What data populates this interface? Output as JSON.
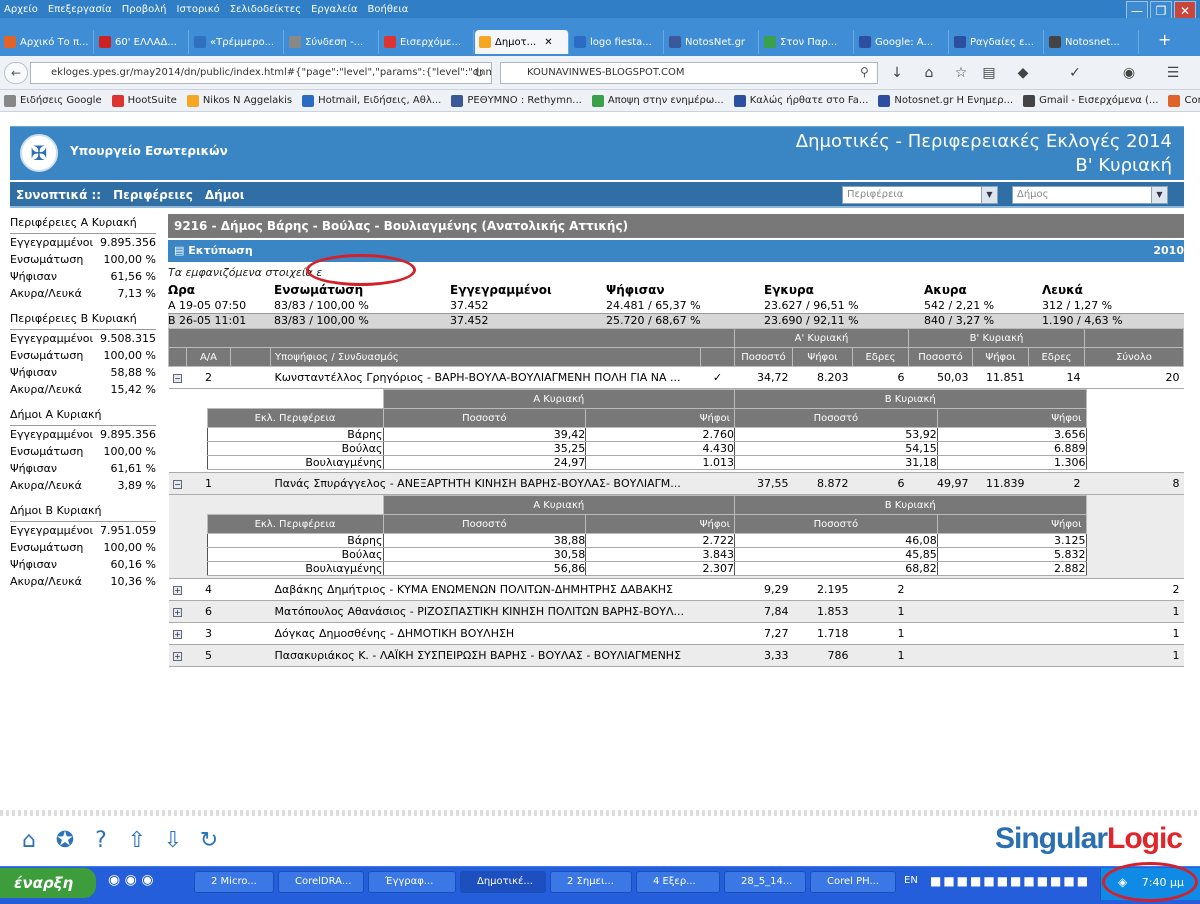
{
  "browser": {
    "menu": [
      "Αρχείο",
      "Επεξεργασία",
      "Προβολή",
      "Ιστορικό",
      "Σελιδοδείκτες",
      "Εργαλεία",
      "Βοήθεια"
    ],
    "tabs": [
      "Αρχικό Το π...",
      "60' ΕΛΛΑΔ...",
      "«Τρέμμερο...",
      "Σύνδεση -...",
      "Εισερχόμε...",
      "Δημοτ...",
      "logo fiesta...",
      "NotosNet.gr",
      "Στον Παρ...",
      "Google: Α...",
      "Ραγδαίες ε...",
      "Notosnet..."
    ],
    "active_tab_index": 5,
    "url": "ekloges.ypes.gr/may2014/dn/public/index.html#{\"page\":\"level\",\"params\":{\"level\":\"dnm",
    "search": "KOUNAVINWES-BLOGSPOT.COM",
    "bookmarks": [
      "Ειδήσεις Google",
      "HootSuite",
      "Nikos N Aggelakis",
      "Hotmail, Ειδήσεις, Αθλ...",
      "ΡΕΘΥΜΝΟ : Rethymn...",
      "Αποψη στην ενημέρω...",
      "Καλώς ήρθατε στο Fa...",
      "Notosnet.gr Η Ενημερ...",
      "Gmail - Εισερχόμενα (...",
      "Control Panel"
    ]
  },
  "header": {
    "ministry": "Υπουργείο Εσωτερικών",
    "title_line1": "Δημοτικές - Περιφερειακές Εκλογές 2014",
    "title_line2": "Β' Κυριακή"
  },
  "nav": {
    "links": [
      "Συνοπτικά ::",
      "Περιφέρειες",
      "Δήμοι"
    ],
    "select_region": "Περιφέρεια",
    "select_municipality": "Δήμος"
  },
  "sidebar": [
    {
      "title": "Περιφέρειες Α Κυριακή",
      "rows": [
        [
          "Εγγεγραμμένοι",
          "9.895.356"
        ],
        [
          "Ενσωμάτωση",
          "100,00 %"
        ],
        [
          "Ψήφισαν",
          "61,56 %"
        ],
        [
          "Ακυρα/Λευκά",
          "7,13 %"
        ]
      ]
    },
    {
      "title": "Περιφέρειες Β Κυριακή",
      "rows": [
        [
          "Εγγεγραμμένοι",
          "9.508.315"
        ],
        [
          "Ενσωμάτωση",
          "100,00 %"
        ],
        [
          "Ψήφισαν",
          "58,88 %"
        ],
        [
          "Ακυρα/Λευκά",
          "15,42 %"
        ]
      ]
    },
    {
      "title": "Δήμοι Α Κυριακή",
      "rows": [
        [
          "Εγγεγραμμένοι",
          "9.895.356"
        ],
        [
          "Ενσωμάτωση",
          "100,00 %"
        ],
        [
          "Ψήφισαν",
          "61,61 %"
        ],
        [
          "Ακυρα/Λευκά",
          "3,89 %"
        ]
      ]
    },
    {
      "title": "Δήμοι Β Κυριακή",
      "rows": [
        [
          "Εγγεγραμμένοι",
          "7.951.059"
        ],
        [
          "Ενσωμάτωση",
          "100,00 %"
        ],
        [
          "Ψήφισαν",
          "60,16 %"
        ],
        [
          "Ακυρα/Λευκά",
          "10,36 %"
        ]
      ]
    }
  ],
  "main": {
    "heading": "9216 - Δήμος Βάρης - Βούλας - Βουλιαγμένης (Ανατολικής Αττικής)",
    "print": "Εκτύπωση",
    "year": "2010",
    "note": "Τα εμφανιζόμενα στοιχεία ε",
    "summary_headers": [
      "Ωρα",
      "Ενσωμάτωση",
      "Εγγεγραμμένοι",
      "Ψήφισαν",
      "Εγκυρα",
      "Ακυρα",
      "Λευκά"
    ],
    "summary_rows": [
      [
        "A 19-05 07:50",
        "83/83 / 100,00 %",
        "37.452",
        "24.481 / 65,37 %",
        "23.627 / 96,51 %",
        "542 / 2,21 %",
        "312 / 1,27 %"
      ],
      [
        "B 26-05 11:01",
        "83/83 / 100,00 %",
        "37.452",
        "25.720 / 68,67 %",
        "23.690 / 92,11 %",
        "840 / 3,27 %",
        "1.190 / 4,63 %"
      ]
    ],
    "group_a": "Α' Κυριακή",
    "group_b": "Β' Κυριακή",
    "result_headers": [
      "Α/Α",
      "Υποψήφιος / Συνδυασμός",
      "Ποσοστό",
      "Ψήφοι",
      "Εδρες",
      "Ποσοστό",
      "Ψήφοι",
      "Εδρες",
      "Σύνολο"
    ],
    "sub_headers": {
      "district": "Εκλ. Περιφέρεια",
      "a": "Α Κυριακή",
      "b": "Β Κυριακή",
      "pct": "Ποσοστό",
      "votes": "Ψήφοι"
    },
    "candidates": [
      {
        "aa": "2",
        "name": "Κωνσταντέλλος Γρηγόριος - ΒΑΡΗ-ΒΟΥΛΑ-ΒΟΥΛΙΑΓΜΕΝΗ ΠΟΛΗ ΓΙΑ ΝΑ ...",
        "check": "✓",
        "a_pct": "34,72",
        "a_votes": "8.203",
        "a_seats": "6",
        "b_pct": "50,03",
        "b_votes": "11.851",
        "b_seats": "14",
        "total": "20",
        "expanded": true,
        "districts": [
          [
            "Βάρης",
            "39,42",
            "2.760",
            "53,92",
            "3.656"
          ],
          [
            "Βούλας",
            "35,25",
            "4.430",
            "54,15",
            "6.889"
          ],
          [
            "Βουλιαγμένης",
            "24,97",
            "1.013",
            "31,18",
            "1.306"
          ]
        ]
      },
      {
        "aa": "1",
        "name": "Πανάς Σπυράγγελος - ΑΝΕΞΑΡΤΗΤΗ ΚΙΝΗΣΗ ΒΑΡΗΣ-ΒΟΥΛΑΣ- ΒΟΥΛΙΑΓΜ...",
        "check": "",
        "a_pct": "37,55",
        "a_votes": "8.872",
        "a_seats": "6",
        "b_pct": "49,97",
        "b_votes": "11.839",
        "b_seats": "2",
        "total": "8",
        "expanded": true,
        "districts": [
          [
            "Βάρης",
            "38,88",
            "2.722",
            "46,08",
            "3.125"
          ],
          [
            "Βούλας",
            "30,58",
            "3.843",
            "45,85",
            "5.832"
          ],
          [
            "Βουλιαγμένης",
            "56,86",
            "2.307",
            "68,82",
            "2.882"
          ]
        ]
      },
      {
        "aa": "4",
        "name": "Δαβάκης Δημήτριος - ΚΥΜΑ ΕΝΩΜΕΝΩΝ ΠΟΛΙΤΩΝ-ΔΗΜΗΤΡΗΣ ΔΑΒΑΚΗΣ",
        "check": "",
        "a_pct": "9,29",
        "a_votes": "2.195",
        "a_seats": "2",
        "b_pct": "",
        "b_votes": "",
        "b_seats": "",
        "total": "2",
        "expanded": false
      },
      {
        "aa": "6",
        "name": "Ματόπουλος Αθανάσιος - ΡΙΖΟΣΠΑΣΤΙΚΗ ΚΙΝΗΣΗ ΠΟΛΙΤΩΝ ΒΑΡΗΣ-ΒΟΥΛ...",
        "check": "",
        "a_pct": "7,84",
        "a_votes": "1.853",
        "a_seats": "1",
        "b_pct": "",
        "b_votes": "",
        "b_seats": "",
        "total": "1",
        "expanded": false
      },
      {
        "aa": "3",
        "name": "Δόγκας Δημοσθένης - ΔΗΜΟΤΙΚΗ ΒΟΥΛΗΣΗ",
        "check": "",
        "a_pct": "7,27",
        "a_votes": "1.718",
        "a_seats": "1",
        "b_pct": "",
        "b_votes": "",
        "b_seats": "",
        "total": "1",
        "expanded": false
      },
      {
        "aa": "5",
        "name": "Πασακυριάκος Κ. - ΛΑΪΚΗ ΣΥΣΠΕΙΡΩΣΗ ΒΑΡΗΣ - ΒΟΥΛΑΣ - ΒΟΥΛΙΑΓΜΕΝΗΣ",
        "check": "",
        "a_pct": "3,33",
        "a_votes": "786",
        "a_seats": "1",
        "b_pct": "",
        "b_votes": "",
        "b_seats": "",
        "total": "1",
        "expanded": false
      }
    ]
  },
  "footer": {
    "brand_a": "Singular",
    "brand_b": "Logic"
  },
  "taskbar": {
    "start": "έναρξη",
    "items": [
      "2 Micro...",
      "CorelDRA...",
      "Έγγραφ...",
      "Δημοτικέ...",
      "2 Σημει...",
      "4 Εξερ...",
      "28_5_14...",
      "Corel PH...",
      "EN"
    ],
    "clock": "7:40 μμ"
  }
}
